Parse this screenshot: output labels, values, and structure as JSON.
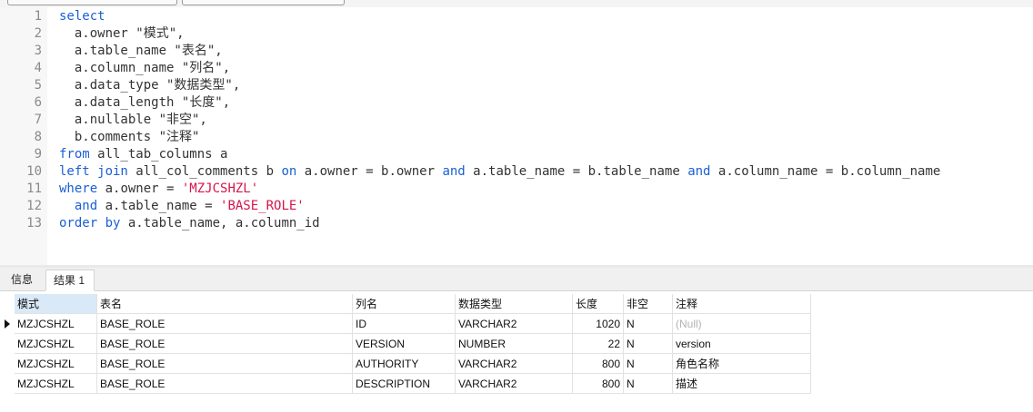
{
  "editor": {
    "lines": [
      {
        "n": "1",
        "tokens": [
          {
            "t": "select",
            "c": "kw"
          }
        ]
      },
      {
        "n": "2",
        "tokens": [
          {
            "t": "  a.owner \"模式\",",
            "c": ""
          }
        ]
      },
      {
        "n": "3",
        "tokens": [
          {
            "t": "  a.table_name \"表名\",",
            "c": ""
          }
        ]
      },
      {
        "n": "4",
        "tokens": [
          {
            "t": "  a.column_name \"列名\",",
            "c": ""
          }
        ]
      },
      {
        "n": "5",
        "tokens": [
          {
            "t": "  a.data_type \"数据类型\",",
            "c": ""
          }
        ]
      },
      {
        "n": "6",
        "tokens": [
          {
            "t": "  a.data_length \"长度\",",
            "c": ""
          }
        ]
      },
      {
        "n": "7",
        "tokens": [
          {
            "t": "  a.nullable \"非空\",",
            "c": ""
          }
        ]
      },
      {
        "n": "8",
        "tokens": [
          {
            "t": "  b.comments \"注释\"",
            "c": ""
          }
        ]
      },
      {
        "n": "9",
        "tokens": [
          {
            "t": "from",
            "c": "kw"
          },
          {
            "t": " all_tab_columns a",
            "c": ""
          }
        ]
      },
      {
        "n": "10",
        "tokens": [
          {
            "t": "left join",
            "c": "kw"
          },
          {
            "t": " all_col_comments b ",
            "c": ""
          },
          {
            "t": "on",
            "c": "kw"
          },
          {
            "t": " a.owner = b.owner ",
            "c": ""
          },
          {
            "t": "and",
            "c": "kw"
          },
          {
            "t": " a.table_name = b.table_name ",
            "c": ""
          },
          {
            "t": "and",
            "c": "kw"
          },
          {
            "t": " a.column_name = b.column_name",
            "c": ""
          }
        ]
      },
      {
        "n": "11",
        "tokens": [
          {
            "t": "where",
            "c": "kw"
          },
          {
            "t": " a.owner = ",
            "c": ""
          },
          {
            "t": "'MZJCSHZL'",
            "c": "str"
          }
        ]
      },
      {
        "n": "12",
        "tokens": [
          {
            "t": "  ",
            "c": ""
          },
          {
            "t": "and",
            "c": "kw"
          },
          {
            "t": " a.table_name = ",
            "c": ""
          },
          {
            "t": "'BASE_ROLE'",
            "c": "str"
          }
        ]
      },
      {
        "n": "13",
        "tokens": [
          {
            "t": "order by",
            "c": "kw"
          },
          {
            "t": " a.table_name, a.column_id",
            "c": ""
          }
        ]
      }
    ]
  },
  "tabs": {
    "info": "信息",
    "result": "结果 1"
  },
  "grid": {
    "columns": [
      "模式",
      "表名",
      "列名",
      "数据类型",
      "长度",
      "非空",
      "注释"
    ],
    "rows": [
      [
        "MZJCSHZL",
        "BASE_ROLE",
        "ID",
        "VARCHAR2",
        "1020",
        "N",
        "(Null)"
      ],
      [
        "MZJCSHZL",
        "BASE_ROLE",
        "VERSION",
        "NUMBER",
        "22",
        "N",
        "version"
      ],
      [
        "MZJCSHZL",
        "BASE_ROLE",
        "AUTHORITY",
        "VARCHAR2",
        "800",
        "N",
        "角色名称"
      ],
      [
        "MZJCSHZL",
        "BASE_ROLE",
        "DESCRIPTION",
        "VARCHAR2",
        "800",
        "N",
        "描述"
      ]
    ]
  }
}
